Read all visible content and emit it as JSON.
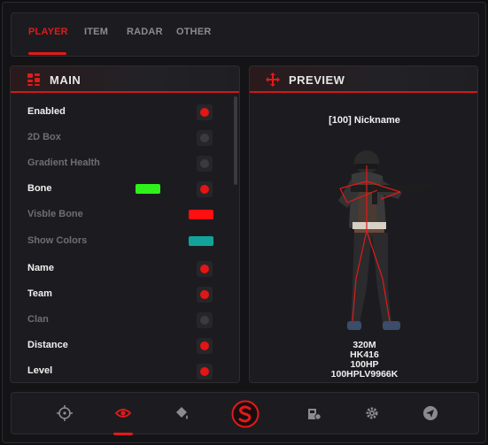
{
  "tabs": [
    {
      "label": "PLAYER",
      "active": true
    },
    {
      "label": "ITEM",
      "active": false
    },
    {
      "label": "RADAR",
      "active": false
    },
    {
      "label": "OTHER",
      "active": false
    }
  ],
  "main": {
    "title": "MAIN",
    "icon": "grid-icon",
    "rows": [
      {
        "label": "Enabled",
        "enabled": true,
        "toggle": true
      },
      {
        "label": "2D Box",
        "enabled": false,
        "toggle": true
      },
      {
        "label": "Gradient Health",
        "enabled": false,
        "toggle": true
      },
      {
        "label": "Bone",
        "enabled": true,
        "toggle": true,
        "color": "#2ef21a"
      },
      {
        "label": "Visble Bone",
        "enabled": false,
        "toggle": false,
        "color": "#ff0f0f"
      },
      {
        "label": "Show Colors",
        "enabled": false,
        "toggle": false,
        "color": "#14a39a"
      },
      {
        "label": "Name",
        "enabled": true,
        "toggle": true
      },
      {
        "label": "Team",
        "enabled": true,
        "toggle": true
      },
      {
        "label": "Clan",
        "enabled": false,
        "toggle": true
      },
      {
        "label": "Distance",
        "enabled": true,
        "toggle": true
      },
      {
        "label": "Level",
        "enabled": true,
        "toggle": true
      }
    ]
  },
  "preview": {
    "title": "PREVIEW",
    "icon": "move-arrows-icon",
    "nickname": "[100] Nickname",
    "stats": [
      "320M",
      "HK416",
      "100HP",
      "100HPLV9966K"
    ]
  },
  "bottom_nav": [
    {
      "icon": "crosshair-icon",
      "active": false
    },
    {
      "icon": "eye-icon",
      "active": true
    },
    {
      "icon": "paint-bucket-icon",
      "active": false
    },
    {
      "icon": "logo-s-icon",
      "active": false
    },
    {
      "icon": "car-settings-icon",
      "active": false
    },
    {
      "icon": "gear-icon",
      "active": false
    },
    {
      "icon": "send-icon",
      "active": false
    }
  ],
  "colors": {
    "accent": "#e01a1a",
    "panel": "#1c1c20",
    "background": "#141417"
  }
}
